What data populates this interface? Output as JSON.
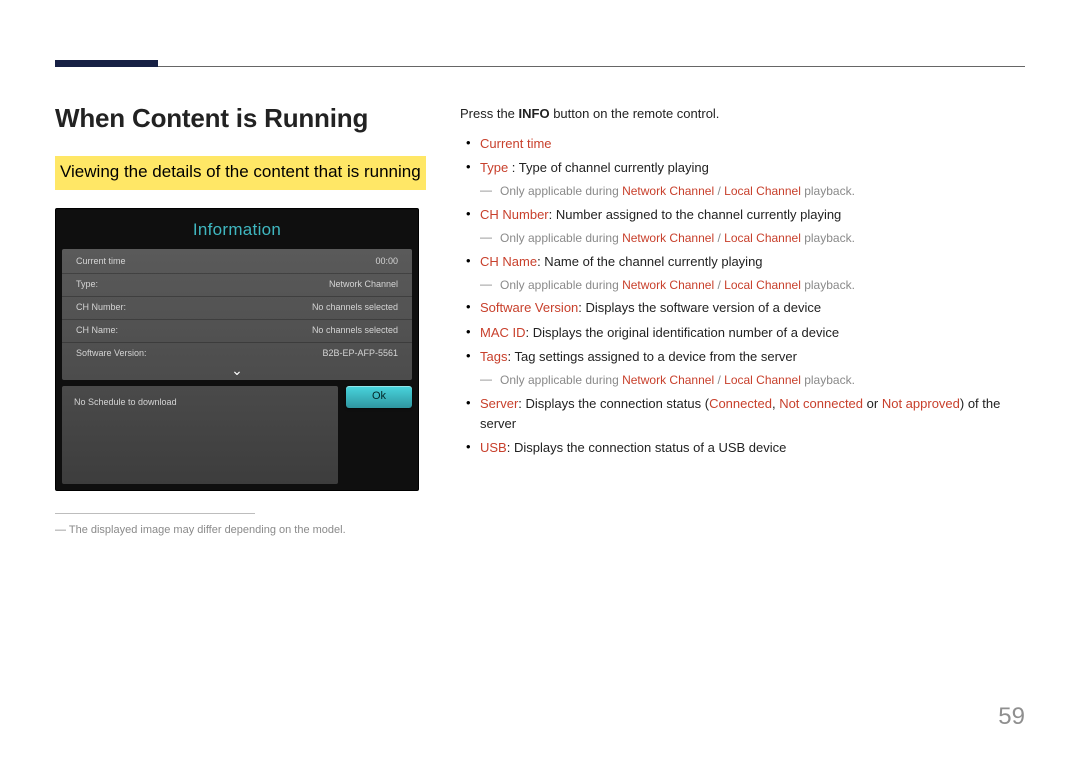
{
  "page_number": "59",
  "heading": "When Content is Running",
  "subheading": "Viewing the details of the content that is running",
  "tv": {
    "title": "Information",
    "rows": [
      {
        "label": "Current time",
        "value": "00:00"
      },
      {
        "label": "Type:",
        "value": "Network Channel"
      },
      {
        "label": "CH Number:",
        "value": "No channels selected"
      },
      {
        "label": "CH Name:",
        "value": "No channels selected"
      },
      {
        "label": "Software Version:",
        "value": "B2B-EP-AFP-5561"
      }
    ],
    "schedule_message": "No Schedule to download",
    "ok_label": "Ok"
  },
  "footnote": "The displayed image may differ depending on the model.",
  "intro_prefix": "Press the ",
  "intro_bold": "INFO",
  "intro_suffix": " button on the remote control.",
  "labels": {
    "current_time": "Current time",
    "type": "Type",
    "type_desc": " : Type of channel currently playing",
    "ch_number": "CH Number",
    "ch_number_desc": ": Number assigned to the channel currently playing",
    "ch_name": "CH Name",
    "ch_name_desc": ": Name of the channel currently playing",
    "sw_version": "Software Version",
    "sw_version_desc": ": Displays the software version of a device",
    "mac_id": "MAC ID",
    "mac_id_desc": ": Displays the original identification number of a device",
    "tags": "Tags",
    "tags_desc": ": Tag settings assigned to a device from the server",
    "server": "Server",
    "server_desc_a": ": Displays the connection status (",
    "server_connected": "Connected",
    "server_sep1": ", ",
    "server_not_connected": "Not connected",
    "server_sep2": " or ",
    "server_not_approved": "Not approved",
    "server_desc_b": ") of the server",
    "usb": "USB",
    "usb_desc": ": Displays the connection status of a USB device"
  },
  "sub_note": {
    "prefix": "Only applicable during ",
    "a": "Network Channel",
    "sep": " / ",
    "b": "Local Channel",
    "suffix": " playback."
  }
}
